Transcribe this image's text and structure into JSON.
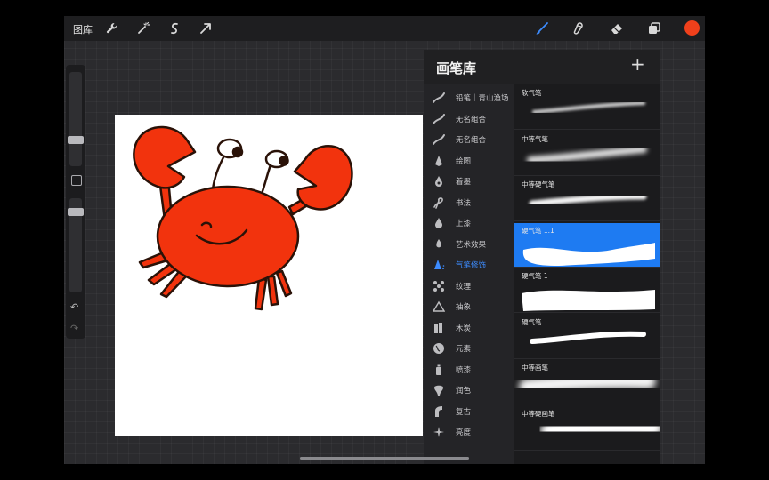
{
  "toolbar": {
    "gallery_label": "图库",
    "left_icons": [
      "wrench-icon",
      "magic-wand-icon",
      "selection-icon",
      "transform-arrow-icon"
    ],
    "right_icons": [
      "brush-icon",
      "smudge-icon",
      "eraser-icon",
      "layers-icon"
    ],
    "active_tool": "brush-icon",
    "active_color": "#f0401b"
  },
  "sidebar": {
    "size_level_percent": 70,
    "opacity_level_percent": 18
  },
  "canvas": {
    "subject": "crab-drawing",
    "crab_color": "#f2330d"
  },
  "brush_library": {
    "title": "画笔库",
    "add_label": "+",
    "categories": [
      {
        "label": "铅笔｜青山渔场",
        "icon": "brush-stroke-icon"
      },
      {
        "label": "无名组合",
        "icon": "brush-stroke-icon"
      },
      {
        "label": "无名组合",
        "icon": "brush-stroke-icon"
      },
      {
        "label": "绘图",
        "icon": "pen-nib-icon"
      },
      {
        "label": "着墨",
        "icon": "ink-drop-icon"
      },
      {
        "label": "书法",
        "icon": "calligraphy-icon"
      },
      {
        "label": "上漆",
        "icon": "paint-drop-icon"
      },
      {
        "label": "艺术效果",
        "icon": "flame-icon"
      },
      {
        "label": "气笔修饰",
        "icon": "airbrush-icon"
      },
      {
        "label": "纹理",
        "icon": "texture-icon"
      },
      {
        "label": "抽象",
        "icon": "triangle-icon"
      },
      {
        "label": "木炭",
        "icon": "charcoal-icon"
      },
      {
        "label": "元素",
        "icon": "globe-icon"
      },
      {
        "label": "喷漆",
        "icon": "spray-can-icon"
      },
      {
        "label": "润色",
        "icon": "blend-icon"
      },
      {
        "label": "复古",
        "icon": "retro-icon"
      },
      {
        "label": "亮度",
        "icon": "sparkle-icon"
      }
    ],
    "active_category_index": 8,
    "brushes": [
      {
        "name": "软气笔"
      },
      {
        "name": "中等气笔"
      },
      {
        "name": "中等硬气笔"
      },
      {
        "name": "硬气笔 1.1"
      },
      {
        "name": "硬气笔 1"
      },
      {
        "name": "硬气笔"
      },
      {
        "name": "中等画笔"
      },
      {
        "name": "中等硬画笔"
      }
    ],
    "selected_brush_index": 3,
    "accent_color": "#1e7bf2"
  }
}
